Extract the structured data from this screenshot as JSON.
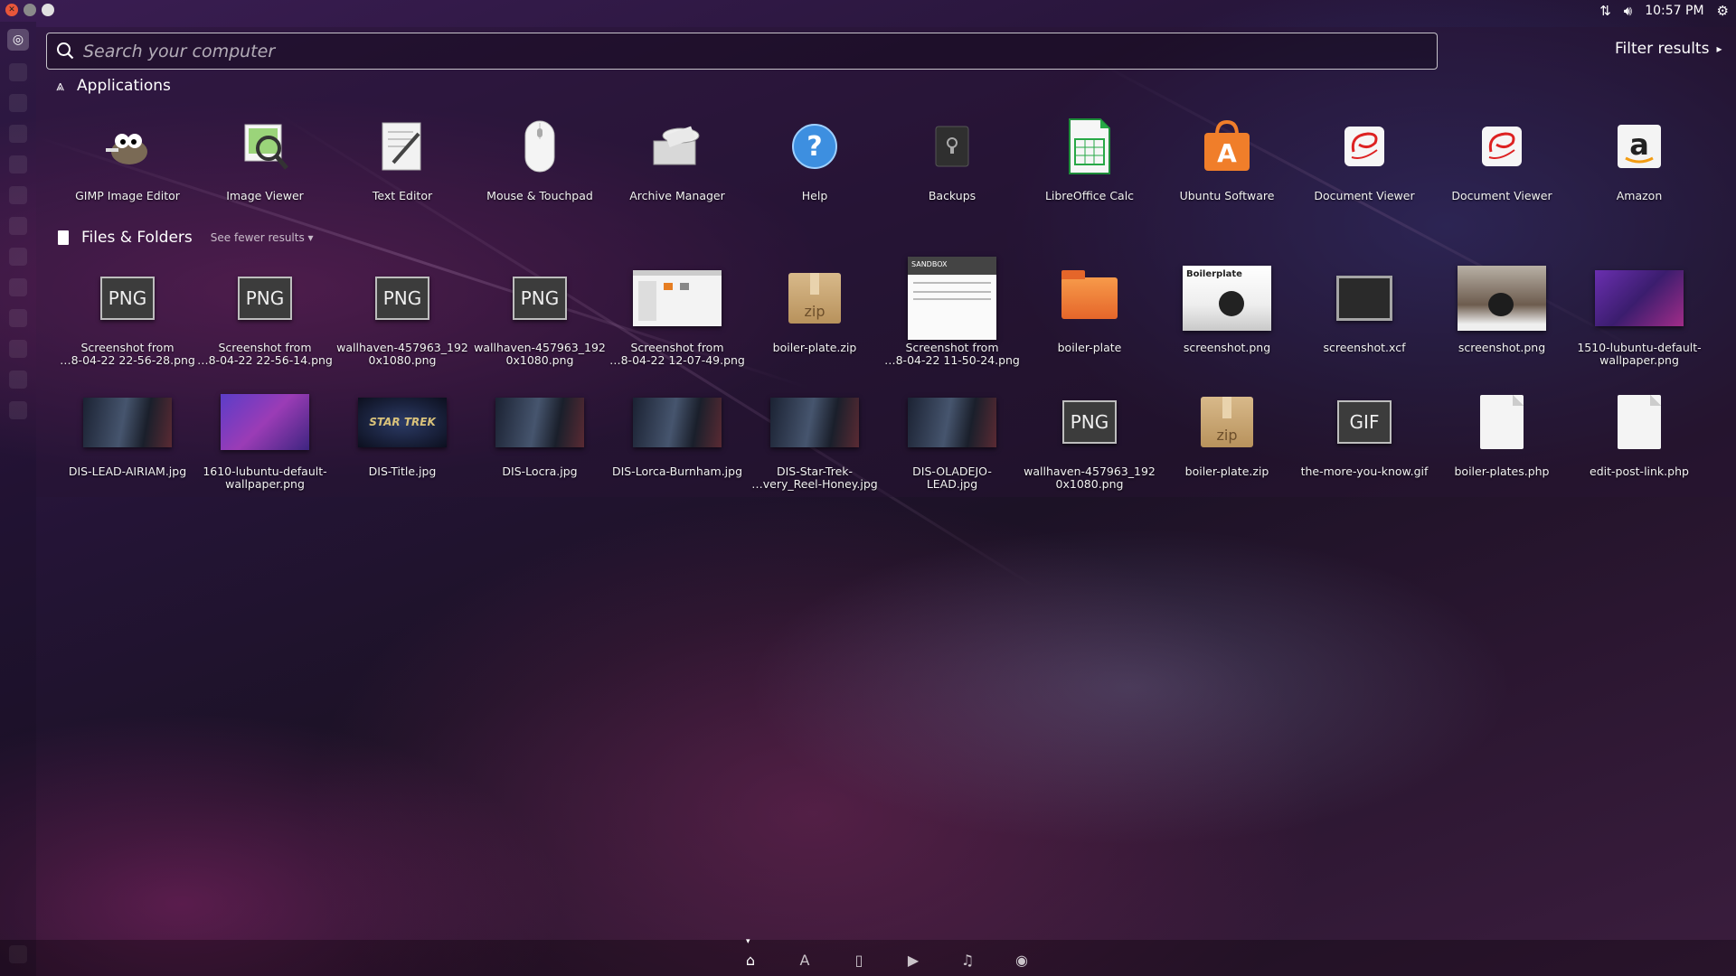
{
  "top_panel": {
    "time": "10:57 PM",
    "icons": [
      "network-icon",
      "volume-icon",
      "gear-icon"
    ]
  },
  "search": {
    "placeholder": "Search your computer",
    "value": ""
  },
  "filter": {
    "label": "Filter results",
    "arrow": "▸"
  },
  "applications": {
    "title": "Applications",
    "items": [
      {
        "label": "GIMP Image Editor",
        "icon": "gimp-icon"
      },
      {
        "label": "Image Viewer",
        "icon": "image-viewer-icon"
      },
      {
        "label": "Text Editor",
        "icon": "text-editor-icon"
      },
      {
        "label": "Mouse & Touchpad",
        "icon": "mouse-icon"
      },
      {
        "label": "Archive Manager",
        "icon": "archive-manager-icon"
      },
      {
        "label": "Help",
        "icon": "help-icon"
      },
      {
        "label": "Backups",
        "icon": "backups-icon"
      },
      {
        "label": "LibreOffice Calc",
        "icon": "libreoffice-calc-icon"
      },
      {
        "label": "Ubuntu Software",
        "icon": "ubuntu-software-icon"
      },
      {
        "label": "Document Viewer",
        "icon": "document-viewer-icon"
      },
      {
        "label": "Document Viewer",
        "icon": "document-viewer-icon"
      },
      {
        "label": "Amazon",
        "icon": "amazon-icon"
      }
    ]
  },
  "files": {
    "title": "Files & Folders",
    "see_fewer": "See fewer results",
    "row1": [
      {
        "label": "Screenshot from\n…8-04-22 22-56-28.png",
        "kind": "png",
        "badge": "PNG"
      },
      {
        "label": "Screenshot from\n…8-04-22 22-56-14.png",
        "kind": "png",
        "badge": "PNG"
      },
      {
        "label": "wallhaven-457963_192\n0x1080.png",
        "kind": "png",
        "badge": "PNG"
      },
      {
        "label": "wallhaven-457963_192\n0x1080.png",
        "kind": "png",
        "badge": "PNG"
      },
      {
        "label": "Screenshot from\n…8-04-22 12-07-49.png",
        "kind": "screenshot-thumb"
      },
      {
        "label": "boiler-plate.zip",
        "kind": "zip",
        "badge": "zip"
      },
      {
        "label": "Screenshot from\n…8-04-22 11-50-24.png",
        "kind": "doc-thumb",
        "badge": "SANDBOX"
      },
      {
        "label": "boiler-plate",
        "kind": "folder"
      },
      {
        "label": "screenshot.png",
        "kind": "boilerplate-thumb",
        "badge": "Boilerplate"
      },
      {
        "label": "screenshot.xcf",
        "kind": "xcf"
      },
      {
        "label": "screenshot.png",
        "kind": "photo-thumb"
      },
      {
        "label": "1510-lubuntu-default-\nwallpaper.png",
        "kind": "wallpaper-thumb"
      }
    ],
    "row2": [
      {
        "label": "DIS-LEAD-AIRIAM.jpg",
        "kind": "photo-dark"
      },
      {
        "label": "1610-lubuntu-default-\nwallpaper.png",
        "kind": "wallpaper-thumb2"
      },
      {
        "label": "DIS-Title.jpg",
        "kind": "star-trek-thumb",
        "badge": "STAR TREK"
      },
      {
        "label": "DIS-Locra.jpg",
        "kind": "photo-dark"
      },
      {
        "label": "DIS-Lorca-Burnham.jpg",
        "kind": "photo-dark"
      },
      {
        "label": "DIS-Star-Trek-\n…very_Reel-Honey.jpg",
        "kind": "photo-dark"
      },
      {
        "label": "DIS-OLADEJO-\nLEAD.jpg",
        "kind": "photo-dark"
      },
      {
        "label": "wallhaven-457963_192\n0x1080.png",
        "kind": "png",
        "badge": "PNG"
      },
      {
        "label": "boiler-plate.zip",
        "kind": "zip",
        "badge": "zip"
      },
      {
        "label": "the-more-you-know.gif",
        "kind": "png",
        "badge": "GIF"
      },
      {
        "label": "boiler-plates.php",
        "kind": "php",
        "badge": "</>"
      },
      {
        "label": "edit-post-link.php",
        "kind": "php",
        "badge": "</>"
      }
    ]
  },
  "scopes": [
    {
      "name": "scope-home-icon",
      "glyph": "⌂",
      "active": true
    },
    {
      "name": "scope-applications-icon",
      "glyph": "A",
      "active": false
    },
    {
      "name": "scope-files-icon",
      "glyph": "▯",
      "active": false
    },
    {
      "name": "scope-video-icon",
      "glyph": "▶",
      "active": false
    },
    {
      "name": "scope-music-icon",
      "glyph": "♫",
      "active": false
    },
    {
      "name": "scope-photos-icon",
      "glyph": "◉",
      "active": false
    }
  ]
}
